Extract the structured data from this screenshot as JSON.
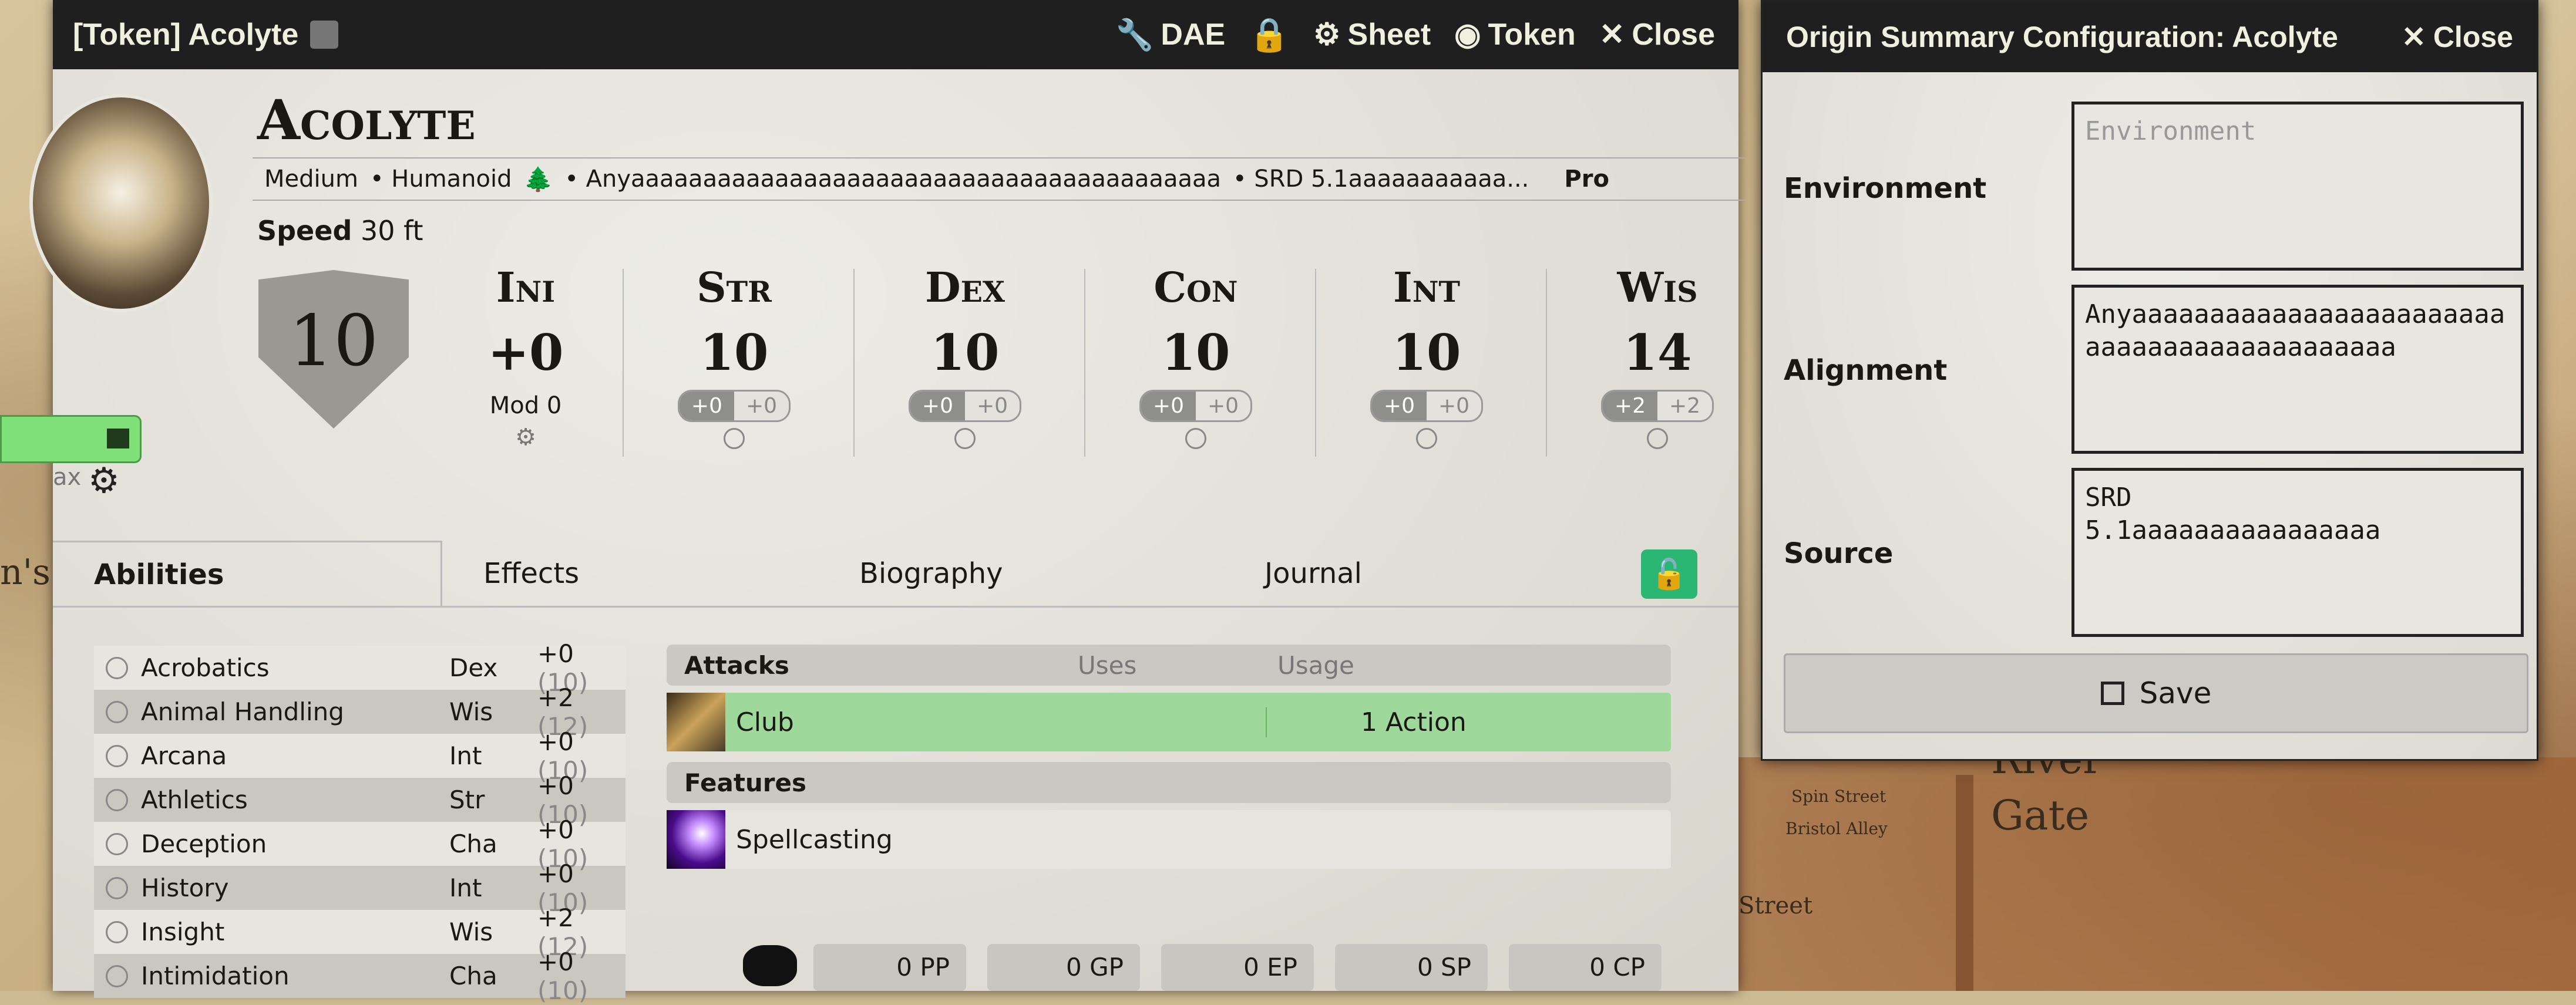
{
  "map": {
    "labels": [
      "River",
      "Gate",
      "Street",
      "Spin Street",
      "Bristol Alley",
      "n's"
    ]
  },
  "sheet": {
    "header": {
      "title": "[Token] Acolyte",
      "dae_label": "DAE",
      "sheet_label": "Sheet",
      "token_label": "Token",
      "close_label": "Close"
    },
    "name": "Acolyte",
    "meta": {
      "size": "Medium",
      "type": "• Humanoid",
      "alignment": "• Anyaaaaaaaaaaaaaaaaaaaaaaaaaaaaaaaaaaaaaaaaa",
      "source": "• SRD 5.1aaaaaaaaaaa...",
      "extra": "Pro"
    },
    "speed_label": "Speed",
    "speed_value": "30 ft",
    "ac": "10",
    "hp_suffix": "ax",
    "initiative": {
      "label": "Ini",
      "value": "+0",
      "mod_label": "Mod",
      "mod_value": "0"
    },
    "abilities": [
      {
        "abbr": "Str",
        "score": "10",
        "mod": "+0",
        "save": "+0"
      },
      {
        "abbr": "Dex",
        "score": "10",
        "mod": "+0",
        "save": "+0"
      },
      {
        "abbr": "Con",
        "score": "10",
        "mod": "+0",
        "save": "+0"
      },
      {
        "abbr": "Int",
        "score": "10",
        "mod": "+0",
        "save": "+0"
      },
      {
        "abbr": "Wis",
        "score": "14",
        "mod": "+2",
        "save": "+2"
      }
    ],
    "tabs": [
      "Abilities",
      "Effects",
      "Biography",
      "Journal"
    ],
    "skills": [
      {
        "name": "Acrobatics",
        "ability": "Dex",
        "mod": "+0",
        "passive": "(10)"
      },
      {
        "name": "Animal Handling",
        "ability": "Wis",
        "mod": "+2",
        "passive": "(12)"
      },
      {
        "name": "Arcana",
        "ability": "Int",
        "mod": "+0",
        "passive": "(10)"
      },
      {
        "name": "Athletics",
        "ability": "Str",
        "mod": "+0",
        "passive": "(10)"
      },
      {
        "name": "Deception",
        "ability": "Cha",
        "mod": "+0",
        "passive": "(10)"
      },
      {
        "name": "History",
        "ability": "Int",
        "mod": "+0",
        "passive": "(10)"
      },
      {
        "name": "Insight",
        "ability": "Wis",
        "mod": "+2",
        "passive": "(12)"
      },
      {
        "name": "Intimidation",
        "ability": "Cha",
        "mod": "+0",
        "passive": "(10)"
      }
    ],
    "attacks": {
      "header": "Attacks",
      "uses": "Uses",
      "usage": "Usage",
      "items": [
        {
          "name": "Club",
          "usage": "1 Action"
        }
      ]
    },
    "features": {
      "header": "Features",
      "items": [
        {
          "name": "Spellcasting"
        }
      ]
    },
    "currency": [
      "0 PP",
      "0 GP",
      "0 EP",
      "0 SP",
      "0 CP"
    ]
  },
  "dialog": {
    "title": "Origin Summary Configuration: Acolyte",
    "close_label": "Close",
    "environment_label": "Environment",
    "environment_placeholder": "Environment",
    "alignment_label": "Alignment",
    "alignment_value": "Anyaaaaaaaaaaaaaaaaaaaaaaaaaaaaaaaaaaaaaaaaaaaa",
    "source_label": "Source",
    "source_value": "SRD\n5.1aaaaaaaaaaaaaaaa",
    "save_label": "Save"
  },
  "colors": {
    "accent_green": "#2bb673",
    "hp_green": "#7fe07a",
    "lock_pink": "#ff8e9a"
  }
}
